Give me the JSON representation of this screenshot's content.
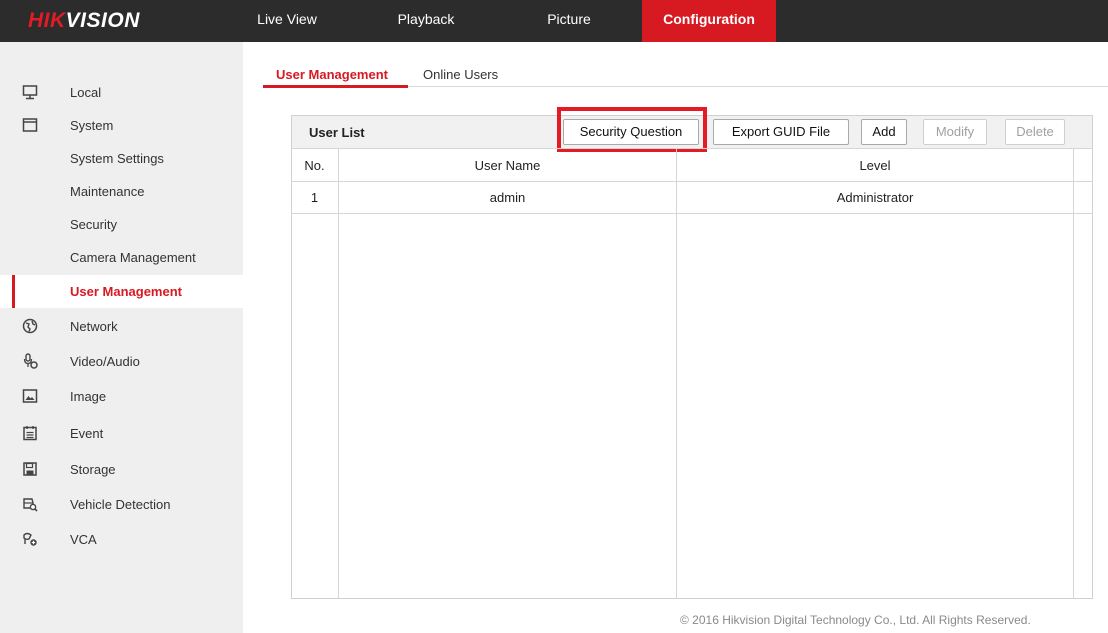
{
  "app": {
    "logo_red": "HIK",
    "logo_white": "VISION"
  },
  "topnav": [
    {
      "label": "Live View",
      "active": false
    },
    {
      "label": "Playback",
      "active": false
    },
    {
      "label": "Picture",
      "active": false
    },
    {
      "label": "Configuration",
      "active": true
    }
  ],
  "sidebar": {
    "items": [
      {
        "label": "Local",
        "icon": "monitor-icon"
      },
      {
        "label": "System",
        "icon": "system-window-icon"
      },
      {
        "label": "System Settings",
        "icon": ""
      },
      {
        "label": "Maintenance",
        "icon": ""
      },
      {
        "label": "Security",
        "icon": ""
      },
      {
        "label": "Camera Management",
        "icon": ""
      },
      {
        "label": "User Management",
        "icon": "",
        "active": true
      },
      {
        "label": "Network",
        "icon": "globe-icon"
      },
      {
        "label": "Video/Audio",
        "icon": "microphone-icon"
      },
      {
        "label": "Image",
        "icon": "image-icon"
      },
      {
        "label": "Event",
        "icon": "calendar-icon"
      },
      {
        "label": "Storage",
        "icon": "floppy-disk-icon"
      },
      {
        "label": "Vehicle Detection",
        "icon": "vehicle-search-icon"
      },
      {
        "label": "VCA",
        "icon": "vca-camera-icon"
      }
    ]
  },
  "tabs": [
    {
      "label": "User Management",
      "active": true
    },
    {
      "label": "Online Users",
      "active": false
    }
  ],
  "user_list": {
    "title": "User List",
    "buttons": {
      "security_question": "Security Question",
      "export_guid": "Export GUID File",
      "add": "Add",
      "modify": "Modify",
      "delete": "Delete"
    },
    "columns": [
      "No.",
      "User Name",
      "Level"
    ],
    "rows": [
      {
        "no": "1",
        "user": "admin",
        "level": "Administrator"
      }
    ]
  },
  "footer": "© 2016 Hikvision Digital Technology Co., Ltd. All Rights Reserved.",
  "colors": {
    "accent": "#d71a21",
    "topbar": "#2c2c2c",
    "sidebar": "#efefef"
  }
}
